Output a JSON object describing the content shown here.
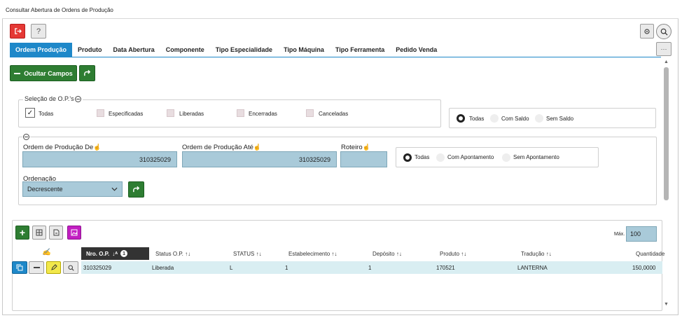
{
  "window": {
    "title": "Consultar Abertura de Ordens de Produção"
  },
  "toolbar": {
    "exit_icon": "exit-icon",
    "help_label": "?",
    "settings_icon": "gear-icon",
    "search_icon": "search-icon",
    "more_label": "···"
  },
  "tabs": [
    {
      "label": "Ordem Produção",
      "active": true
    },
    {
      "label": "Produto"
    },
    {
      "label": "Data Abertura"
    },
    {
      "label": "Componente"
    },
    {
      "label": "Tipo Especialidade"
    },
    {
      "label": "Tipo Máquina"
    },
    {
      "label": "Tipo Ferramenta"
    },
    {
      "label": "Pedido Venda"
    }
  ],
  "actions": {
    "hide_fields_label": "Ocultar Campos"
  },
  "selecao": {
    "legend": "Seleção de O.P.'s",
    "options": [
      {
        "label": "Todas",
        "checked": true
      },
      {
        "label": "Especificadas"
      },
      {
        "label": "Liberadas"
      },
      {
        "label": "Encerradas"
      },
      {
        "label": "Canceladas"
      }
    ]
  },
  "saldo": {
    "options": [
      "Todas",
      "Com Saldo",
      "Sem Saldo"
    ],
    "selected": "Todas"
  },
  "filters": {
    "op_de_label": "Ordem de Produção De",
    "op_de_value": "310325029",
    "op_ate_label": "Ordem de Produção Até",
    "op_ate_value": "310325029",
    "roteiro_label": "Roteiro",
    "roteiro_value": "",
    "ordenacao_label": "Ordenação",
    "ordenacao_value": "Decrescente"
  },
  "apontamento": {
    "options": [
      "Todas",
      "Com Apontamento",
      "Sem Apontamento"
    ],
    "selected": "Todas"
  },
  "grid": {
    "max_label": "Máx.",
    "max_value": "100",
    "sort_badge": "1",
    "columns": [
      "Nro. O.P.",
      "Status O.P.",
      "STATUS",
      "Estabelecimento",
      "Depósito",
      "Produto",
      "Tradução",
      "Quantidade"
    ],
    "rows": [
      [
        "310325029",
        "Liberada",
        "L",
        "1",
        "1",
        "170521",
        "LANTERNA",
        "150,0000"
      ]
    ]
  },
  "colors": {
    "accent": "#1e88c9",
    "green": "#2e7d32",
    "field": "#a9cad9",
    "row_highlight": "#d9eef2"
  }
}
